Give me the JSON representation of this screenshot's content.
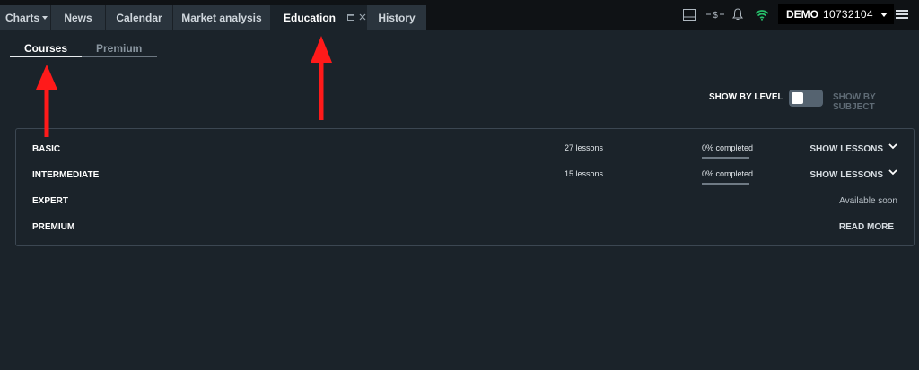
{
  "topbar": {
    "tabs": [
      {
        "label": "Charts"
      },
      {
        "label": "News"
      },
      {
        "label": "Calendar"
      },
      {
        "label": "Market analysis"
      },
      {
        "label": "Education"
      },
      {
        "label": "History"
      }
    ],
    "account": {
      "mode": "DEMO",
      "number": "10732104"
    }
  },
  "education": {
    "subtabs": [
      {
        "label": "Courses"
      },
      {
        "label": "Premium"
      }
    ],
    "toggle": {
      "left_label": "SHOW BY LEVEL",
      "right_label": "SHOW BY SUBJECT"
    },
    "levels": [
      {
        "name": "BASIC",
        "lessons": "27 lessons",
        "completed": "0% completed",
        "action": "SHOW LESSONS"
      },
      {
        "name": "INTERMEDIATE",
        "lessons": "15 lessons",
        "completed": "0% completed",
        "action": "SHOW LESSONS"
      },
      {
        "name": "EXPERT",
        "status": "Available soon"
      },
      {
        "name": "PREMIUM",
        "action": "READ MORE"
      }
    ]
  },
  "colors": {
    "accent_wifi": "#27c06b",
    "annotation_arrow": "#ff1a1a"
  }
}
